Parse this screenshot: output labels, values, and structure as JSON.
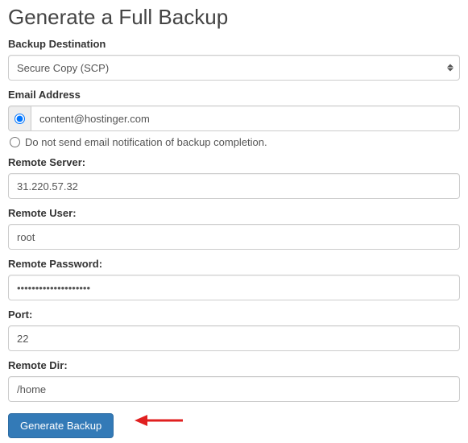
{
  "title": "Generate a Full Backup",
  "destination": {
    "label": "Backup Destination",
    "value": "Secure Copy (SCP)"
  },
  "email": {
    "label": "Email Address",
    "value": "content@hostinger.com",
    "skip_label": "Do not send email notification of backup completion."
  },
  "remote_server": {
    "label": "Remote Server:",
    "value": "31.220.57.32"
  },
  "remote_user": {
    "label": "Remote User:",
    "value": "root"
  },
  "remote_password": {
    "label": "Remote Password:",
    "value": "••••••••••••••••••••"
  },
  "port": {
    "label": "Port:",
    "value": "22"
  },
  "remote_dir": {
    "label": "Remote Dir:",
    "value": "/home"
  },
  "button": {
    "label": "Generate Backup"
  }
}
